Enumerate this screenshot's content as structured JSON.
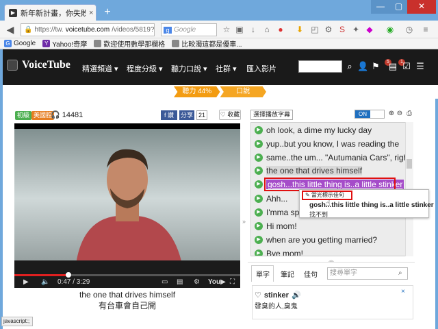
{
  "browser": {
    "tab_title": "新年新計畫，你失敗了嗎?...",
    "tab_close": "×",
    "new_tab": "+",
    "url_prefix": "https://tw.",
    "url_domain": "voicetube.com",
    "url_path": "/videos/5819?ref=tra",
    "search_engine": "g",
    "search_placeholder": "Google",
    "win_min": "—",
    "win_max": "▢",
    "win_close": "✕"
  },
  "bookmarks": [
    {
      "label": "Google",
      "color": "#4a86e8",
      "icon": "G"
    },
    {
      "label": "Yahoo!奇摩",
      "color": "#6f2da8",
      "icon": "Y"
    },
    {
      "label": "歡迎使用數學那欄格",
      "color": "#888888",
      "icon": ""
    },
    {
      "label": "比較濁這都是優車...",
      "color": "#888888",
      "icon": ""
    }
  ],
  "site": {
    "logo": "VoiceTube",
    "nav": [
      "精選頻道 ▾",
      "程度分級 ▾",
      "聽力口說 ▾",
      "社群 ▾",
      "匯入影片"
    ],
    "badge_notifications": "5",
    "badge_tasks": "1"
  },
  "strip": {
    "listening": "聽力 44%",
    "speaking": "口說"
  },
  "video": {
    "tag_level": "初級",
    "tag_lang": "美國腔",
    "views": "14481",
    "fb": "f 讚",
    "share": "分享",
    "share_count": "21",
    "favorite": "♡ 收藏",
    "time": "0:47 / 3:29",
    "progress": 0.24,
    "sub_en": "the one that drives himself",
    "sub_zh": "有台車會自己開"
  },
  "panel": {
    "select_subtitle": "選擇播放字幕 ▾",
    "toggle_on": "ON",
    "lines": [
      "oh look, a dime my lucky day",
      "yup..but you know, I was reading the",
      "same..the um... \"Autumania Cars\", right?",
      "the one that drives himself",
      "gosh...this little thing is..a little stinker",
      "Ahh...",
      "I'mma spe",
      "Hi mom!",
      "when are you getting married?",
      "Bye mom!"
    ],
    "popup_button": "✎ 當光標示佳句",
    "popup_line": "gosh...this little thing is..a little stinker",
    "popup_not_found": "找不到"
  },
  "dict": {
    "tabs": [
      "單字",
      "筆記",
      "佳句"
    ],
    "search_placeholder": "搜尋單字",
    "word": "stinker",
    "definition": "發臭的人,臭鬼",
    "close": "×"
  },
  "status": "javascript:;"
}
